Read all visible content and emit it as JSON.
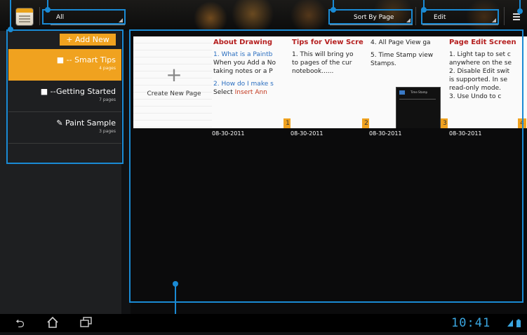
{
  "toolbar": {
    "filter_value": "All",
    "sort_value": "Sort By Page",
    "edit_value": "Edit",
    "app_icon": "notebook-app-icon",
    "menu_icon": "overflow-menu-icon"
  },
  "sidebar": {
    "add_new_label": "+ Add New",
    "notebooks": [
      {
        "title": "■ -- Smart Tips",
        "pages": "4 pages",
        "selected": true
      },
      {
        "title": "■ --Getting Started",
        "pages": "7 pages",
        "selected": false
      },
      {
        "title": "✎ Paint Sample",
        "pages": "3 pages",
        "selected": false
      }
    ]
  },
  "main": {
    "create_label": "Create New Page",
    "pages": [
      {
        "number": "1",
        "date": "08-30-2011",
        "title": "About Drawing",
        "line1": "1. What is a Paintb",
        "line2": "When you Add a No",
        "line3": "taking notes or a P",
        "line4": "2. How do I make s",
        "line5a": "Select ",
        "line5b": "Insert Ann"
      },
      {
        "number": "2",
        "date": "08-30-2011",
        "title": "Tips for View Scre",
        "line1": "1. This will bring yo",
        "line2": "to pages of the cur",
        "line3": "notebook......"
      },
      {
        "number": "3",
        "date": "08-30-2011",
        "line1": "4. All Page View ga",
        "line2": "5. Time Stamp view",
        "line3": "Stamps.",
        "thumb_label": "Time Stamp"
      },
      {
        "number": "4",
        "date": "08-30-2011",
        "title": "Page Edit Screen",
        "line1": "1. Light tap to set c",
        "line2": "anywhere on the se",
        "line3": "2. Disable Edit swit",
        "line4": "is supported. In se",
        "line5": "read-only mode.",
        "line6": "3. Use Undo to c"
      }
    ]
  },
  "system": {
    "clock": "10:41",
    "back_icon": "back-icon",
    "home_icon": "home-icon",
    "recents_icon": "recent-apps-icon",
    "status_icons": "wifi-battery-icons"
  },
  "colors": {
    "accent": "#f0a21f",
    "annotation": "#1a8ad4",
    "clock": "#3aa6e0"
  }
}
